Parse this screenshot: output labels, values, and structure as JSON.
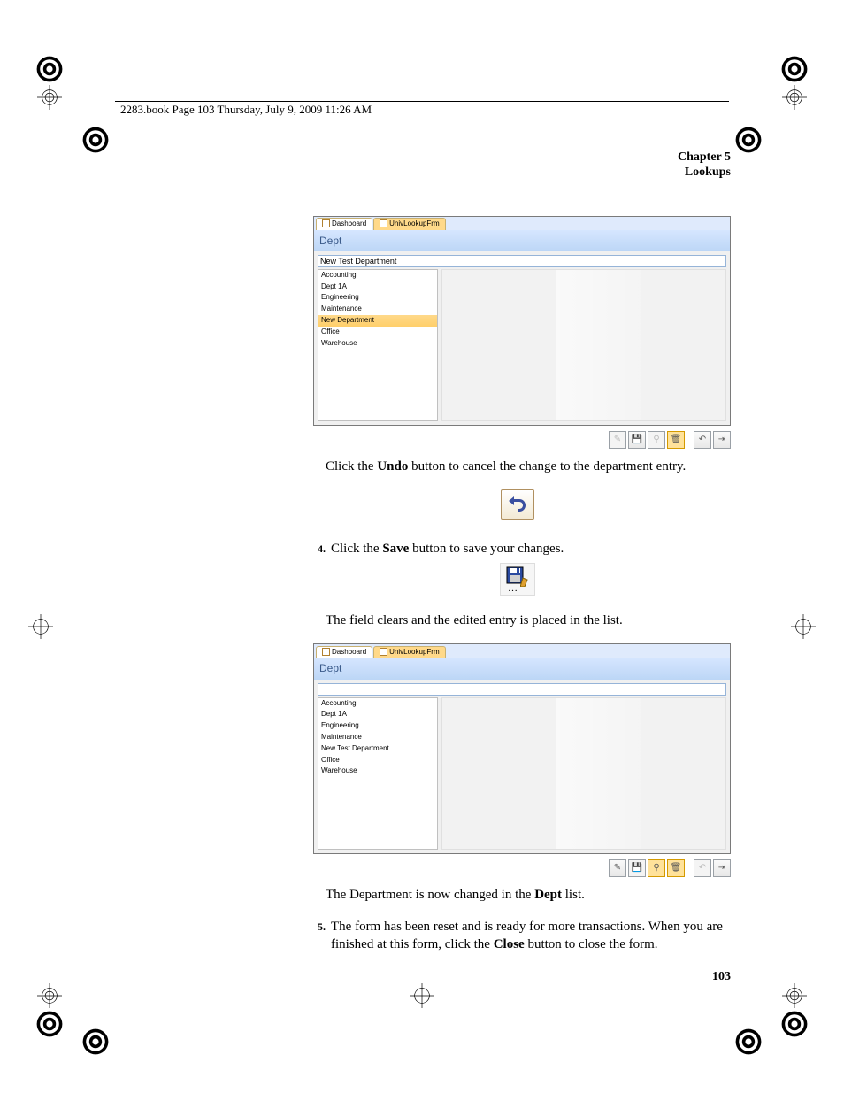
{
  "header_text": "2283.book  Page 103  Thursday, July 9, 2009  11:26 AM",
  "chapter_line1": "Chapter 5",
  "chapter_line2": "Lookups",
  "screenshot1": {
    "tab1": "Dashboard",
    "tab2": "UnivLookupFrm",
    "title": "Dept",
    "input_value": "New Test Department",
    "rows": [
      "Accounting",
      "Dept 1A",
      "Engineering",
      "Maintenance",
      "New Department",
      "Office",
      "Warehouse"
    ],
    "selected_index": 4
  },
  "para1_a": "Click the ",
  "para1_b": "Undo",
  "para1_c": " button to cancel the change to the department entry.",
  "step4_num": "4.",
  "step4_a": "Click the ",
  "step4_b": "Save",
  "step4_c": " button to save your changes.",
  "para2": "The field clears and the edited entry is placed in the list.",
  "screenshot2": {
    "tab1": "Dashboard",
    "tab2": "UnivLookupFrm",
    "title": "Dept",
    "input_value": "",
    "rows": [
      "Accounting",
      "Dept 1A",
      "Engineering",
      "Maintenance",
      "New Test Department",
      "Office",
      "Warehouse"
    ],
    "selected_index": -1
  },
  "para3_a": "The Department is now changed in the ",
  "para3_b": "Dept",
  "para3_c": " list.",
  "step5_num": "5.",
  "step5_txt_a": "The form has been reset and is ready for more transactions. When you are finished at this form, click the ",
  "step5_txt_b": "Close",
  "step5_txt_c": " button to close the form.",
  "page_number": "103"
}
